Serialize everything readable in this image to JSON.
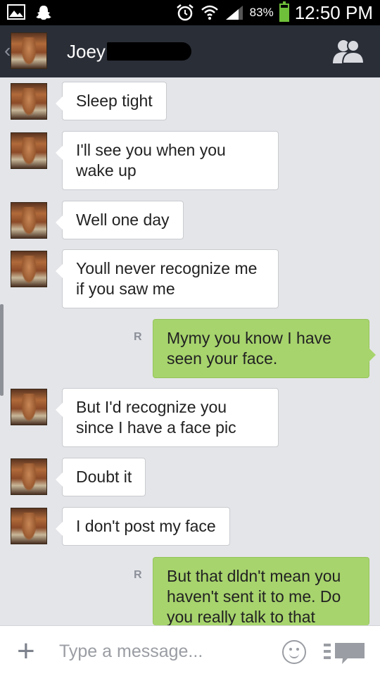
{
  "status_bar": {
    "battery_percent": "83%",
    "battery_level": 0.83,
    "time": "12:50 PM"
  },
  "header": {
    "back_symbol": "‹",
    "contact_name": "Joey ."
  },
  "messages": [
    {
      "side": "left",
      "text": "Sleep tight"
    },
    {
      "side": "left",
      "text": "I'll see you when you wake up"
    },
    {
      "side": "left",
      "text": "Well one day"
    },
    {
      "side": "left",
      "text": "Youll never recognize me if you saw me"
    },
    {
      "side": "right",
      "read_mark": "R",
      "text": "Mymy you know I have seen your face."
    },
    {
      "side": "left",
      "text": "But I'd recognize you since I have a face pic"
    },
    {
      "side": "left",
      "text": "Doubt it"
    },
    {
      "side": "left",
      "text": "I don't post my face"
    },
    {
      "side": "right",
      "read_mark": "R",
      "text": "But that dldn't mean you haven't sent it to me. Do you really talk to that"
    }
  ],
  "input_bar": {
    "plus_symbol": "+",
    "placeholder": "Type a message..."
  },
  "icons": {
    "left": [
      "image-icon",
      "snapchat-icon"
    ],
    "right": [
      "alarm-icon",
      "wifi-icon",
      "signal-icon",
      "battery-icon"
    ],
    "header": "profile-icon",
    "input": [
      "plus-icon",
      "emoji-icon",
      "more-options-icon"
    ]
  },
  "colors": {
    "header_bg": "#2a2e37",
    "chat_bg": "#e4e5e9",
    "sent_bubble": "#a7d46d",
    "received_bubble": "#ffffff",
    "battery": "#6fbf3a"
  }
}
